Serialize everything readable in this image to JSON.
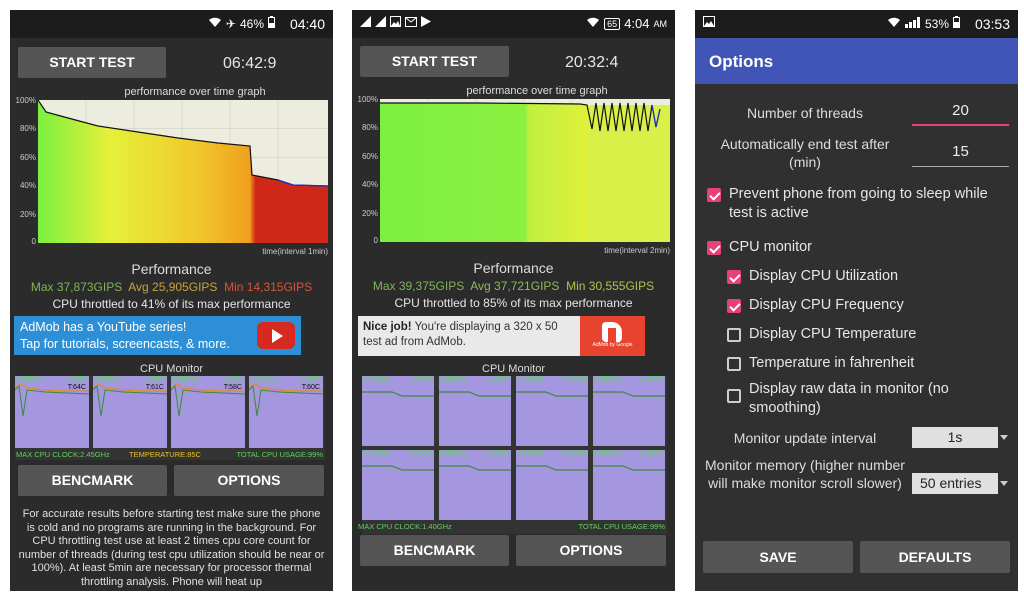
{
  "screen1": {
    "status": {
      "battery": "46%",
      "time": "04:40"
    },
    "start_button": "START TEST",
    "timer": "06:42:9",
    "graph_title": "performance over time graph",
    "y_ticks": [
      "100%",
      "80%",
      "60%",
      "40%",
      "20%",
      "0"
    ],
    "x_label": "time(interval 1min)",
    "perf_title": "Performance",
    "max": "Max 37,873GIPS",
    "avg": "Avg 25,905GIPS",
    "min": "Min 14,315GIPS",
    "throttle": "CPU throttled to 41% of its max performance",
    "ad_line1": "AdMob has a YouTube series!",
    "ad_line2": "Tap for tutorials, screencasts, & more.",
    "monitor_title": "CPU Monitor",
    "cores": [
      {
        "freq": "1.09GHz",
        "usage": "U:99%",
        "temp": "T:64C"
      },
      {
        "freq": "1.09GHz",
        "usage": "U:99%",
        "temp": "T:61C"
      },
      {
        "freq": "1.09GHz",
        "usage": "U:96%",
        "temp": "T:58C"
      },
      {
        "freq": "1.01GHz",
        "usage": "U:99%",
        "temp": "T:60C"
      }
    ],
    "footer_clock": "MAX CPU CLOCK:2.45GHz",
    "footer_temp": "TEMPERATURE:85C",
    "footer_usage": "TOTAL CPU USAGE:99%",
    "bench_button": "BENCMARK",
    "options_button": "OPTIONS",
    "info_text": "For accurate results before starting test make sure the phone is cold and no programs are running in the background. For CPU throttling test use at least 2 times cpu core count for number of threads (during test cpu utilization should be near or 100%). At least 5min are necessary for processor thermal throttling analysis. Phone will heat up"
  },
  "screen2": {
    "status": {
      "battery": "65",
      "time": "4:04",
      "ampm": "AM"
    },
    "start_button": "START TEST",
    "timer": "20:32:4",
    "graph_title": "performance over time graph",
    "y_ticks": [
      "100%",
      "80%",
      "60%",
      "40%",
      "20%",
      "0"
    ],
    "x_label": "time(interval 2min)",
    "perf_title": "Performance",
    "max": "Max 39,375GIPS",
    "avg": "Avg 37,721GIPS",
    "min": "Min 30,555GIPS",
    "throttle": "CPU throttled to 85% of its max performance",
    "ad_bold": "Nice job!",
    "ad_text": "You're displaying a 320 x 50 test ad from AdMob.",
    "ad_logo_text": "AdMob by Google",
    "monitor_title": "CPU Monitor",
    "cores_top": [
      {
        "freq": "1.09GHz",
        "usage": "U:99%"
      },
      {
        "freq": "1.09GHz",
        "usage": "U:100%"
      },
      {
        "freq": "1.09GHz",
        "usage": "U:100%"
      },
      {
        "freq": "1.09GHz",
        "usage": "U:100%"
      }
    ],
    "cores_bottom": [
      {
        "freq": "0.90GHz",
        "usage": "U:100%"
      },
      {
        "freq": "0.90GHz",
        "usage": "U:100%"
      },
      {
        "freq": "0.90GHz",
        "usage": "U:100%"
      },
      {
        "freq": "0.90GHz",
        "usage": "U:100%"
      }
    ],
    "footer_clock": "MAX CPU CLOCK:1.40GHz",
    "footer_usage": "TOTAL CPU USAGE:99%",
    "bench_button": "BENCMARK",
    "options_button": "OPTIONS"
  },
  "screen3": {
    "status": {
      "battery": "53%",
      "time": "03:53"
    },
    "title": "Options",
    "threads_label": "Number of threads",
    "threads_value": "20",
    "end_label": "Automatically end test after (min)",
    "end_value": "15",
    "checkboxes": [
      {
        "label": "Prevent phone from going to sleep while test is active",
        "checked": true
      },
      {
        "label": "CPU monitor",
        "checked": true
      },
      {
        "label": "Display CPU Utilization",
        "checked": true
      },
      {
        "label": "Display CPU Frequency",
        "checked": true
      },
      {
        "label": "Display CPU Temperature",
        "checked": false
      },
      {
        "label": "Temperature in fahrenheit",
        "checked": false
      },
      {
        "label": "Display raw data in monitor (no smoothing)",
        "checked": false
      }
    ],
    "interval_label": "Monitor update interval",
    "interval_value": "1s",
    "memory_label": "Monitor memory (higher number will make monitor scroll slower)",
    "memory_value": "50 entries",
    "save_button": "SAVE",
    "defaults_button": "DEFAULTS"
  },
  "colors": {
    "accent": "#e8407a",
    "appbar": "#4055b5",
    "monitor_bg": "#a596e0",
    "freq_text": "#5fd25f"
  }
}
